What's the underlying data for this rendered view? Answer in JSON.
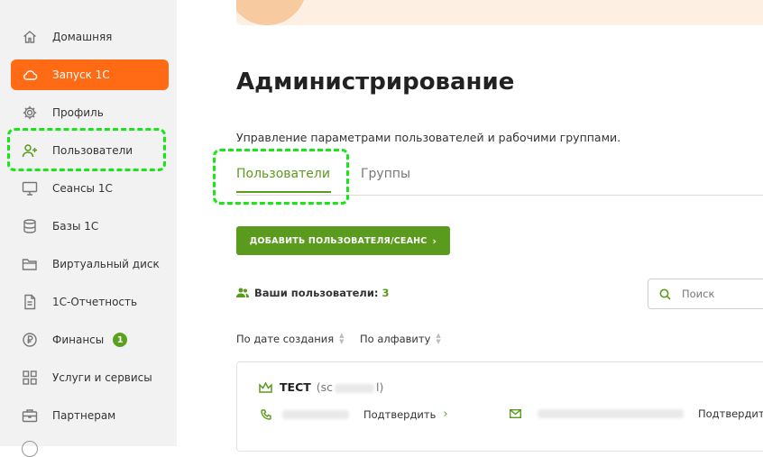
{
  "sidebar": {
    "items": [
      {
        "label": "Домашняя",
        "icon": "home-icon"
      },
      {
        "label": "Запуск 1С",
        "icon": "cloud-icon",
        "active": true
      },
      {
        "label": "Профиль",
        "icon": "gear-icon"
      },
      {
        "label": "Пользователи",
        "icon": "add-user-icon",
        "highlighted": true
      },
      {
        "label": "Сеансы 1С",
        "icon": "monitor-icon"
      },
      {
        "label": "Базы 1С",
        "icon": "database-icon"
      },
      {
        "label": "Виртуальный диск",
        "icon": "folder-icon"
      },
      {
        "label": "1С-Отчетность",
        "icon": "document-icon"
      },
      {
        "label": "Финансы",
        "icon": "ruble-icon",
        "badge": "1"
      },
      {
        "label": "Услуги и сервисы",
        "icon": "grid-icon"
      },
      {
        "label": "Партнерам",
        "icon": "briefcase-icon"
      }
    ]
  },
  "main": {
    "title": "Администрирование",
    "description": "Управление параметрами пользователей и рабочими группами.",
    "tabs": [
      {
        "label": "Пользователи",
        "active": true
      },
      {
        "label": "Группы",
        "active": false
      }
    ],
    "add_button": "ДОБАВИТЬ ПОЛЬЗОВАТЕЛЯ/СЕАНС",
    "users_count_label": "Ваши пользователи:",
    "users_count": "3",
    "search_placeholder": "Поиск",
    "sort": {
      "by_date": "По дате создания",
      "by_alpha": "По алфавиту"
    },
    "user_card": {
      "name": "ТЕСТ",
      "login_prefix": "(sc",
      "login_suffix": "l)",
      "confirm_phone": "Подтвердить",
      "confirm_email": "Подтвердить"
    }
  },
  "colors": {
    "accent_orange": "#ff6a14",
    "accent_green": "#5a9a1c",
    "highlight_dash": "#19e619"
  }
}
